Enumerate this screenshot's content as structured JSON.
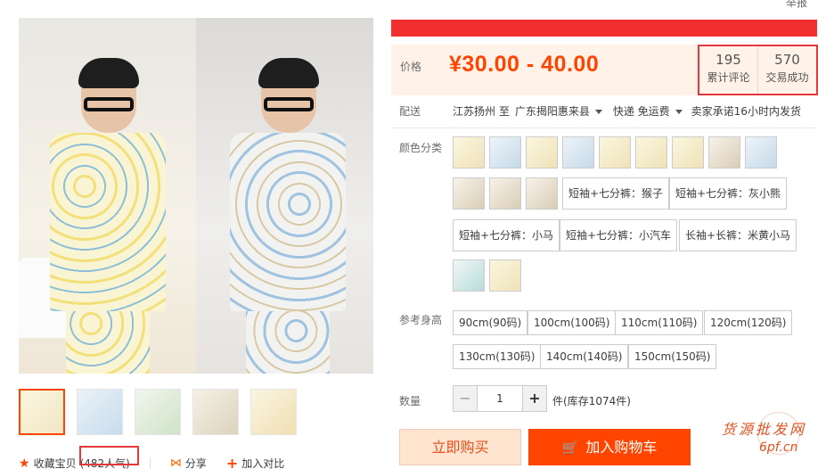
{
  "header": {
    "report_label": "举报"
  },
  "gallery": {
    "thumb_count": 5
  },
  "bottom_actions": {
    "favorite_label": "收藏宝贝",
    "popularity": "(482人气)",
    "share_label": "分享",
    "compare_label": "加入对比"
  },
  "price": {
    "label": "价格",
    "value": "¥30.00 - 40.00"
  },
  "stats": {
    "reviews_count": "195",
    "reviews_label": "累计评论",
    "sales_count": "570",
    "sales_label": "交易成功"
  },
  "shipping": {
    "label": "配送",
    "from": "江苏扬州 至",
    "to": "广东揭阳惠来县",
    "method": "快递 免运费",
    "promise": "卖家承诺16小时内发货"
  },
  "color": {
    "label": "颜色分类",
    "text_options": [
      "短袖+七分裤：猴子",
      "短袖+七分裤：灰小熊",
      "短袖+七分裤：小马",
      "短袖+七分裤：小汽车",
      "长袖+长裤：米黄小马"
    ]
  },
  "size": {
    "label": "参考身高",
    "options": [
      "90cm(90码)",
      "100cm(100码)",
      "110cm(110码)",
      "120cm(120码)",
      "130cm(130码)",
      "140cm(140码)",
      "150cm(150码)"
    ]
  },
  "quantity": {
    "label": "数量",
    "minus": "−",
    "value": "1",
    "plus": "+",
    "stock": "件(库存1074件)"
  },
  "buttons": {
    "buy_now": "立即购买",
    "add_to_cart": "加入购物车"
  },
  "watermark": {
    "text": "货源批发网",
    "url": "6pf.cn"
  },
  "colors": {
    "accent": "#ff4400",
    "price": "#ff4400",
    "highlight_border": "#e4393c",
    "banner": "#f23030"
  }
}
